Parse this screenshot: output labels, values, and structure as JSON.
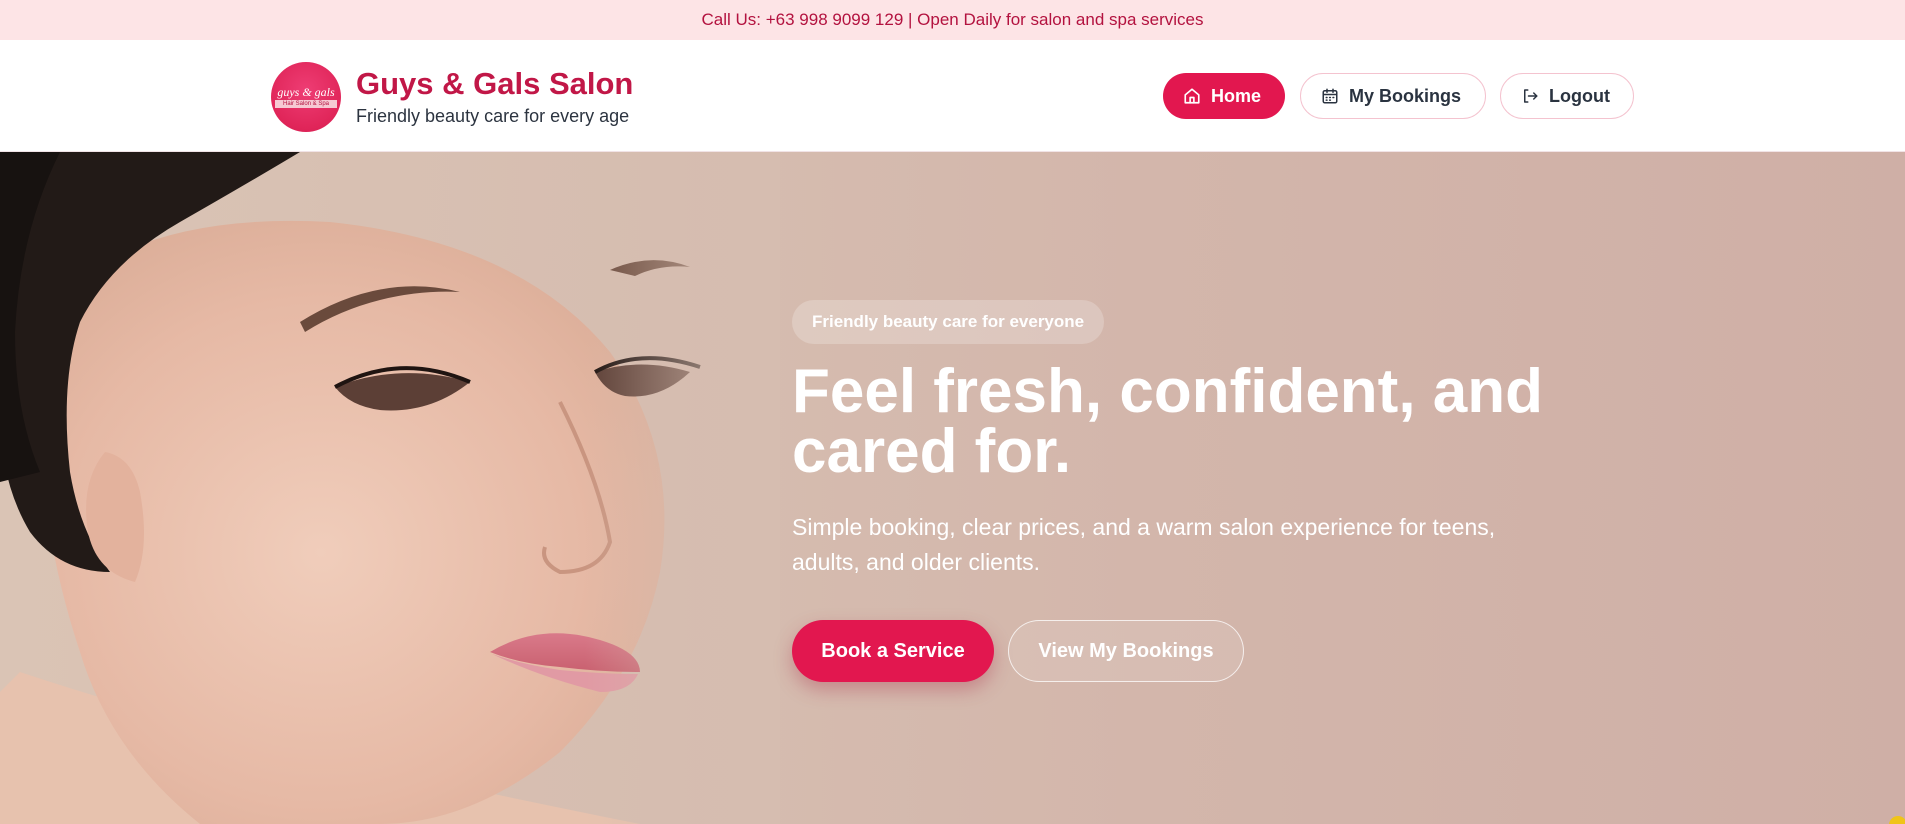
{
  "topbar": {
    "text": "Call Us: +63 998 9099 129 | Open Daily for salon and spa services"
  },
  "brand": {
    "logo_line1": "guys & gals",
    "logo_line2": "Hair Salon & Spa",
    "name": "Guys & Gals Salon",
    "tagline": "Friendly beauty care for every age"
  },
  "nav": {
    "home": {
      "label": "Home",
      "icon": "home-icon"
    },
    "bookings": {
      "label": "My Bookings",
      "icon": "calendar-icon"
    },
    "logout": {
      "label": "Logout",
      "icon": "logout-icon"
    }
  },
  "hero": {
    "badge": "Friendly beauty care for everyone",
    "headline": "Feel fresh, confident, and cared for.",
    "subtext": "Simple booking, clear prices, and a warm salon experience for teens, adults, and older clients.",
    "cta_primary": "Book a Service",
    "cta_secondary": "View My Bookings"
  },
  "colors": {
    "accent": "#e2174f",
    "brand_text": "#c11747",
    "topbar_bg": "#fde4e6",
    "topbar_text": "#b3123f",
    "hero_bg": "#d6bdb0"
  }
}
